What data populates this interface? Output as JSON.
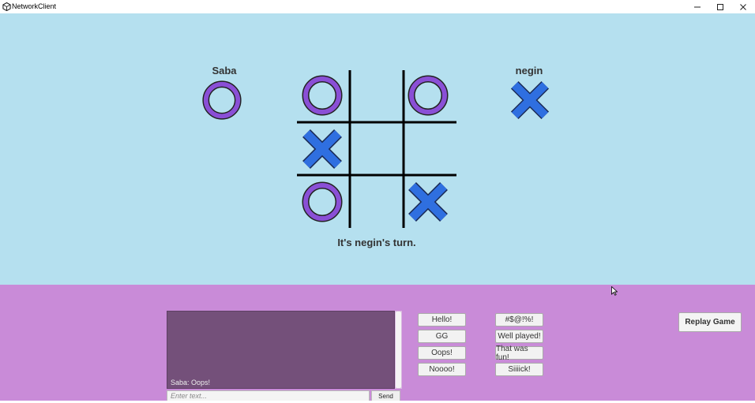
{
  "window": {
    "title": "NetworkClient"
  },
  "players": {
    "left": {
      "name": "Saba",
      "symbol": "O"
    },
    "right": {
      "name": "negin",
      "symbol": "X"
    }
  },
  "board": {
    "cells": [
      "O",
      "",
      "O",
      "X",
      "",
      "",
      "O",
      "",
      "X"
    ]
  },
  "status": {
    "turn_text": "It's negin's turn."
  },
  "chat": {
    "messages": [
      "Saba: Oops!"
    ],
    "input_placeholder": "Enter text...",
    "send_label": "Send"
  },
  "quick_messages": {
    "col1": [
      "Hello!",
      "GG",
      "Oops!",
      "Noooo!"
    ],
    "col2": [
      "#$@!%!",
      "Well played!",
      "That was fun!",
      "Siiiick!"
    ]
  },
  "actions": {
    "replay_label": "Replay Game"
  },
  "colors": {
    "sky": "#b5e0ef",
    "panel": "#c98bd8",
    "o_color": "#8a4fd6",
    "x_color": "#2f6fe0"
  }
}
